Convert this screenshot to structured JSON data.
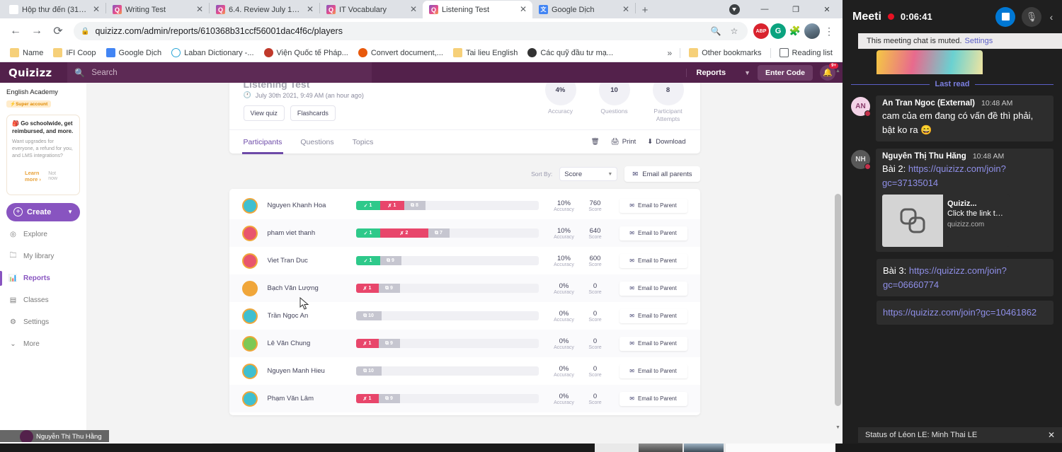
{
  "browser": {
    "tabs": [
      {
        "label": "Hộp thư đến (31) - thu",
        "favicon": "gmail-icon",
        "active": false
      },
      {
        "label": "Writing Test",
        "favicon": "quizizz-icon",
        "active": false
      },
      {
        "label": "6.4. Review July 12 21",
        "favicon": "quizizz-icon",
        "active": false
      },
      {
        "label": "IT Vocabulary",
        "favicon": "quizizz-icon",
        "active": false
      },
      {
        "label": "Listening Test",
        "favicon": "quizizz-icon",
        "active": true
      },
      {
        "label": "Google Dịch",
        "favicon": "google-translate-icon",
        "active": false
      }
    ],
    "new_tab_label": "+",
    "window_controls": {
      "minimize": "—",
      "maximize": "❐",
      "close": "✕"
    },
    "url": "quizizz.com/admin/reports/610368b31ccf56001dac4f6c/players",
    "bookmarks": [
      {
        "label": "Name",
        "icon": "folder-icon"
      },
      {
        "label": "IFI Coop",
        "icon": "folder-icon"
      },
      {
        "label": "Google Dịch",
        "icon": "google-translate-icon"
      },
      {
        "label": "Laban Dictionary -...",
        "icon": "laban-icon"
      },
      {
        "label": "Viện Quốc tế Pháp...",
        "icon": "vien-icon"
      },
      {
        "label": "Convert document,...",
        "icon": "convert-icon"
      },
      {
        "label": "Tai lieu English",
        "icon": "folder-icon"
      },
      {
        "label": "Các quỹ đầu tư mạ...",
        "icon": "globe-icon"
      }
    ],
    "overflow_label": "»",
    "other_bookmarks": "Other bookmarks",
    "reading_list": "Reading list"
  },
  "quizizz": {
    "logo": "Quizizz",
    "search_placeholder": "Search",
    "reports_label": "Reports",
    "enter_code_label": "Enter Code",
    "notification_badge": "9+",
    "sidebar": {
      "account_name": "English Academy",
      "account_tag": "Super account",
      "promo": {
        "title": "Go schoolwide, get reimbursed, and more.",
        "desc": "Want upgrades for everyone, a refund for you, and LMS integrations?",
        "learn_more": "Learn more ›",
        "not_now": "Not now"
      },
      "create_label": "Create",
      "items": [
        {
          "label": "Explore",
          "icon": "compass-icon",
          "active": false
        },
        {
          "label": "My library",
          "icon": "folder-icon",
          "active": false
        },
        {
          "label": "Reports",
          "icon": "chart-icon",
          "active": true
        },
        {
          "label": "Classes",
          "icon": "classes-icon",
          "active": false
        },
        {
          "label": "Settings",
          "icon": "gear-icon",
          "active": false
        },
        {
          "label": "More",
          "icon": "chevron-down-icon",
          "active": false
        }
      ]
    },
    "report": {
      "title": "Listening Test",
      "date": "July 30th 2021, 9:49 AM (an hour ago)",
      "buttons": [
        "View quiz",
        "Flashcards"
      ],
      "stats": [
        {
          "value": "4%",
          "label": "Accuracy"
        },
        {
          "value": "10",
          "label": "Questions"
        },
        {
          "value": "8",
          "label": "Participant Attempts"
        }
      ],
      "tabs": [
        {
          "label": "Participants",
          "active": true
        },
        {
          "label": "Questions",
          "active": false
        },
        {
          "label": "Topics",
          "active": false
        }
      ],
      "actions": [
        {
          "label": "",
          "icon": "trash-icon"
        },
        {
          "label": "Print",
          "icon": "printer-icon"
        },
        {
          "label": "Download",
          "icon": "download-icon"
        }
      ],
      "sort_by_label": "Sort By:",
      "sort_by_value": "Score",
      "email_all_label": "Email all parents",
      "email_to_parent_label": "Email to Parent",
      "accuracy_label": "Accuracy",
      "score_label": "Score",
      "players": [
        {
          "name": "Nguyen Khanh Hoa",
          "correct": "1",
          "incorrect": "1",
          "skipped": "8",
          "accuracy": "10%",
          "score": "760",
          "avatar_color": "#3fbfd0",
          "solid_btn": false
        },
        {
          "name": "pham viet thanh",
          "correct": "1",
          "incorrect": "2",
          "skipped": "7",
          "accuracy": "10%",
          "score": "640",
          "avatar_color": "#e8556d",
          "solid_btn": false
        },
        {
          "name": "Viet Tran Duc",
          "correct": "1",
          "incorrect": "",
          "skipped": "9",
          "accuracy": "10%",
          "score": "600",
          "avatar_color": "#e8556d",
          "solid_btn": true
        },
        {
          "name": "Bạch Văn Lượng",
          "correct": "",
          "incorrect": "1",
          "skipped": "9",
          "accuracy": "0%",
          "score": "0",
          "avatar_color": "#f0a63a",
          "solid_btn": false
        },
        {
          "name": "Trần Ngọc An",
          "correct": "",
          "incorrect": "",
          "skipped": "10",
          "accuracy": "0%",
          "score": "0",
          "avatar_color": "#3fbfd0",
          "solid_btn": false
        },
        {
          "name": "Lê Văn Chung",
          "correct": "",
          "incorrect": "1",
          "skipped": "9",
          "accuracy": "0%",
          "score": "0",
          "avatar_color": "#7dc855",
          "solid_btn": false
        },
        {
          "name": "Nguyen Manh Hieu",
          "correct": "",
          "incorrect": "",
          "skipped": "10",
          "accuracy": "0%",
          "score": "0",
          "avatar_color": "#3fbfd0",
          "solid_btn": false
        },
        {
          "name": "Phạm Văn Lâm",
          "correct": "",
          "incorrect": "1",
          "skipped": "9",
          "accuracy": "0%",
          "score": "0",
          "avatar_color": "#3fbfd0",
          "solid_btn": false
        }
      ]
    },
    "name_tooltip": "Nguyễn Thị Thu Hằng"
  },
  "teams": {
    "title": "Meeti",
    "timer": "0:06:41",
    "muted_notice": "This meeting chat is muted.",
    "muted_settings_link": "Settings",
    "last_read_label": "Last read",
    "messages": [
      {
        "initials": "AN",
        "author": "An Tran Ngoc (External)",
        "time": "10:48 AM",
        "text": "cam của em đang có vấn đề thì phải, bật ko ra 😄"
      },
      {
        "initials": "NH",
        "author": "Nguyễn Thị Thu Hằng",
        "time": "10:48 AM",
        "prefix": "Bài 2: ",
        "link": "https://quizizz.com/join?gc=37135014",
        "card": {
          "title": "Quiziz...",
          "desc": "Click the link to...",
          "domain": "quizizz.com"
        }
      }
    ],
    "plain_messages": [
      {
        "prefix": "Bài 3: ",
        "link": "https://quizizz.com/join?gc=06660774"
      },
      {
        "prefix": "",
        "link": "https://quizizz.com/join?gc=10461862"
      }
    ],
    "status_text": "Status of Léon LE: Minh Thai LE",
    "status_close": "✕"
  },
  "colors": {
    "quizizz_purple": "#53214b",
    "accent_purple": "#8854c0",
    "correct_green": "#2ec98a",
    "incorrect_red": "#e8466b",
    "skipped_gray": "#c6c6d0",
    "teams_dark": "#1f1f1f",
    "teams_blue": "#0078d4",
    "record_red": "#e81123"
  }
}
